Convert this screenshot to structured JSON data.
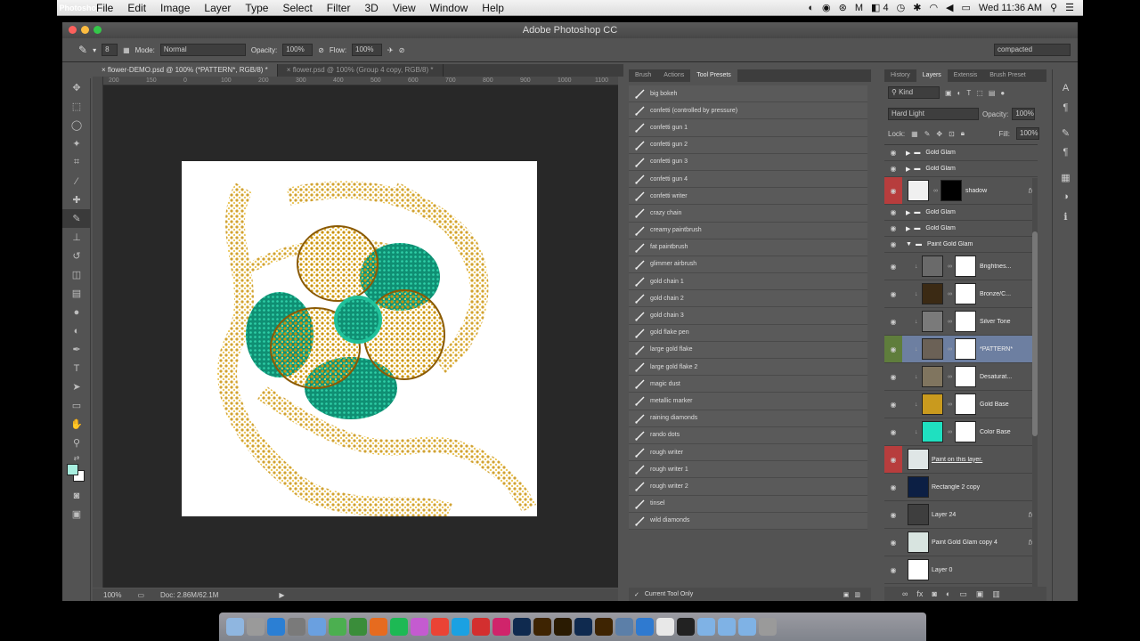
{
  "menubar": {
    "apple": "",
    "app_name": "Photoshop",
    "menus": [
      "File",
      "Edit",
      "Image",
      "Layer",
      "Type",
      "Select",
      "Filter",
      "3D",
      "View",
      "Window",
      "Help"
    ],
    "status_extra": "4",
    "clock": "Wed 11:36 AM"
  },
  "window": {
    "title": "Adobe Photoshop CC"
  },
  "options": {
    "mode_label": "Mode:",
    "mode_value": "Normal",
    "opacity_label": "Opacity:",
    "opacity_value": "100%",
    "flow_label": "Flow:",
    "flow_value": "100%",
    "brush_size": "8",
    "workspace": "compacted"
  },
  "doc_tabs": [
    {
      "label": "flower-DEMO.psd @ 100% (*PATTERN*, RGB/8) *",
      "active": true
    },
    {
      "label": "flower.psd @ 100% (Group 4 copy, RGB/8) *",
      "active": false
    }
  ],
  "ruler_labels": [
    "200",
    "150",
    "0",
    "100",
    "200",
    "300",
    "400",
    "500",
    "600",
    "700",
    "800",
    "900",
    "1000",
    "1100"
  ],
  "doc_status": {
    "zoom": "100%",
    "doc": "Doc: 2.86M/62.1M"
  },
  "tool_presets_panel": {
    "tabs": [
      {
        "label": "Brush",
        "active": false
      },
      {
        "label": "Actions",
        "active": false
      },
      {
        "label": "Tool Presets",
        "active": true
      }
    ],
    "items": [
      "big bokeh",
      "confetti (controlled by pressure)",
      "confetti gun 1",
      "confetti gun 2",
      "confetti gun 3",
      "confetti gun 4",
      "confetti writer",
      "crazy chain",
      "creamy paintbrush",
      "fat paintbrush",
      "glimmer airbrush",
      "gold chain 1",
      "gold chain 2",
      "gold chain 3",
      "gold flake pen",
      "large gold flake",
      "large gold flake 2",
      "magic dust",
      "metallic marker",
      "raining diamonds",
      "rando dots",
      "rough writer",
      "rough writer 1",
      "rough writer 2",
      "tinsel",
      "wild diamonds"
    ],
    "footer_label": "Current Tool Only"
  },
  "layers_panel": {
    "tabs": [
      {
        "label": "History",
        "active": false
      },
      {
        "label": "Layers",
        "active": true
      },
      {
        "label": "Extensis",
        "active": false
      },
      {
        "label": "Brush Preset",
        "active": false
      }
    ],
    "filter_kind": "Kind",
    "blend_mode": "Hard Light",
    "opacity_label": "Opacity:",
    "opacity_value": "100%",
    "lock_label": "Lock:",
    "fill_label": "Fill:",
    "fill_value": "100%",
    "layers": [
      {
        "name": "Gold Glam",
        "type": "group"
      },
      {
        "name": "Gold Glam",
        "type": "group"
      },
      {
        "name": "shadow",
        "type": "masked",
        "eye": "red",
        "fx": true
      },
      {
        "name": "Gold Glam",
        "type": "group"
      },
      {
        "name": "Gold Glam",
        "type": "group"
      },
      {
        "name": "Paint Gold Glam",
        "type": "group-open"
      },
      {
        "name": "Brightnes...",
        "type": "adjust",
        "thumb_color": "#6a6a6a"
      },
      {
        "name": "Bronze/C...",
        "type": "adjust",
        "thumb_color": "#3b2a14"
      },
      {
        "name": "Silver Tone",
        "type": "adjust",
        "thumb_color": "#7a7a7a"
      },
      {
        "name": "*PATTERN*",
        "type": "adjust",
        "thumb_color": "#6b6156",
        "selected": true,
        "eye": "green"
      },
      {
        "name": "Desaturat...",
        "type": "adjust",
        "thumb_color": "#80755f"
      },
      {
        "name": "Gold Base",
        "type": "adjust",
        "thumb_color": "#c99a1e"
      },
      {
        "name": "Color Base",
        "type": "adjust",
        "thumb_color": "#1fe0c0"
      },
      {
        "name": "Paint on this layer.",
        "type": "plain",
        "eye": "red",
        "thumb_color": "#dfe6e6"
      },
      {
        "name": "Rectangle 2 copy",
        "type": "plain",
        "thumb_color": "#0c1f44"
      },
      {
        "name": "Layer 24",
        "type": "plain",
        "thumb_color": "#3e3e3e",
        "fx": true
      },
      {
        "name": "Paint Gold Glam copy 4",
        "type": "plain",
        "thumb_color": "#d8e4e0",
        "fx": true
      },
      {
        "name": "Layer 0",
        "type": "plain",
        "thumb_color": "#ffffff"
      }
    ]
  },
  "colors": {
    "fg": "#a8efe0",
    "bg": "#ffffff"
  },
  "dock_apps": [
    "finder",
    "launchpad",
    "safari",
    "settings",
    "mail",
    "messages",
    "facetime",
    "firefox",
    "spotify",
    "itunes",
    "chrome",
    "skype",
    "acrobat",
    "indesign",
    "photoshop",
    "illustrator",
    "bridge",
    "photoshop-2",
    "illustrator-2",
    "preview",
    "app-store",
    "calendar",
    "terminal",
    "folder",
    "folder-2",
    "folder-3",
    "trash"
  ]
}
